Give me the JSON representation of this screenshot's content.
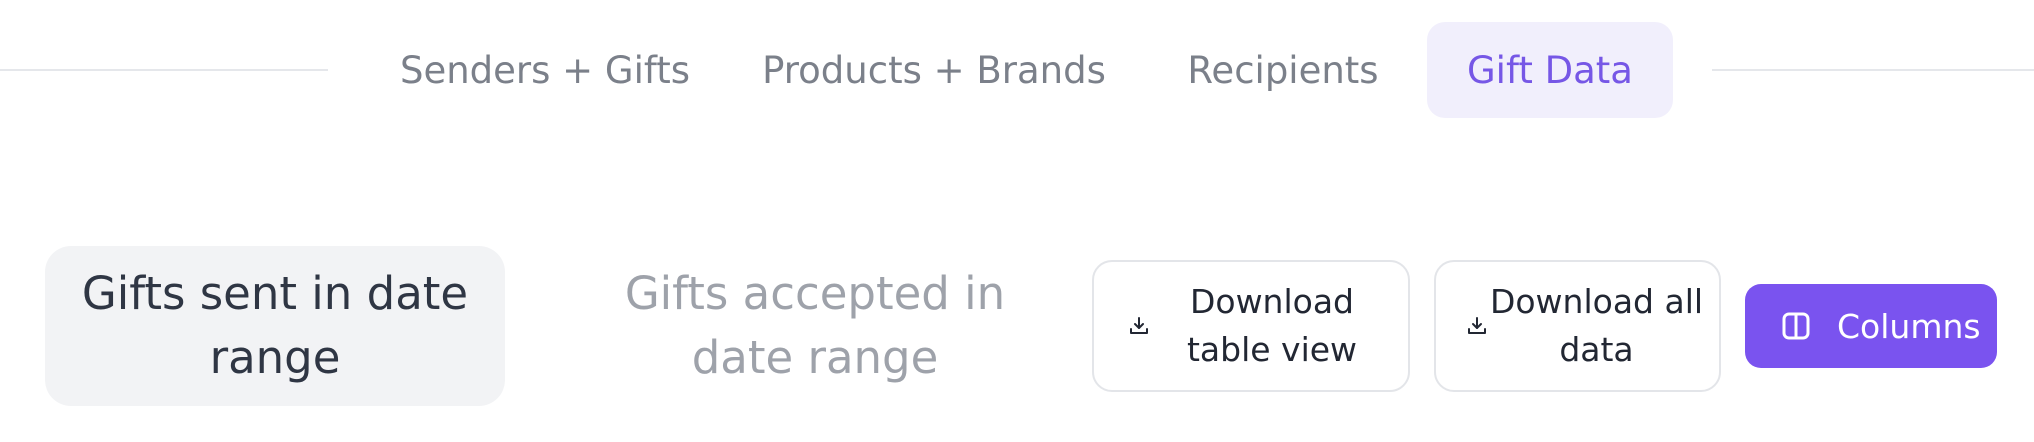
{
  "tabs": [
    {
      "label": "Senders + Gifts",
      "active": false
    },
    {
      "label": "Products + Brands",
      "active": false
    },
    {
      "label": "Recipients",
      "active": false
    },
    {
      "label": "Gift Data",
      "active": true
    }
  ],
  "toggle": {
    "selected": "Gifts sent in date range",
    "unselected": "Gifts accepted in date range"
  },
  "actions": {
    "download_table": {
      "label": "Download table view",
      "icon": "download-icon"
    },
    "download_all": {
      "label": "Download all data",
      "icon": "download-icon"
    },
    "columns": {
      "label": "Columns",
      "icon": "columns-icon"
    }
  },
  "colors": {
    "accent": "#7a53ef",
    "active_tab_bg": "#f1effc",
    "active_tab_text": "#7657e6",
    "inactive_text": "#7b808a"
  }
}
